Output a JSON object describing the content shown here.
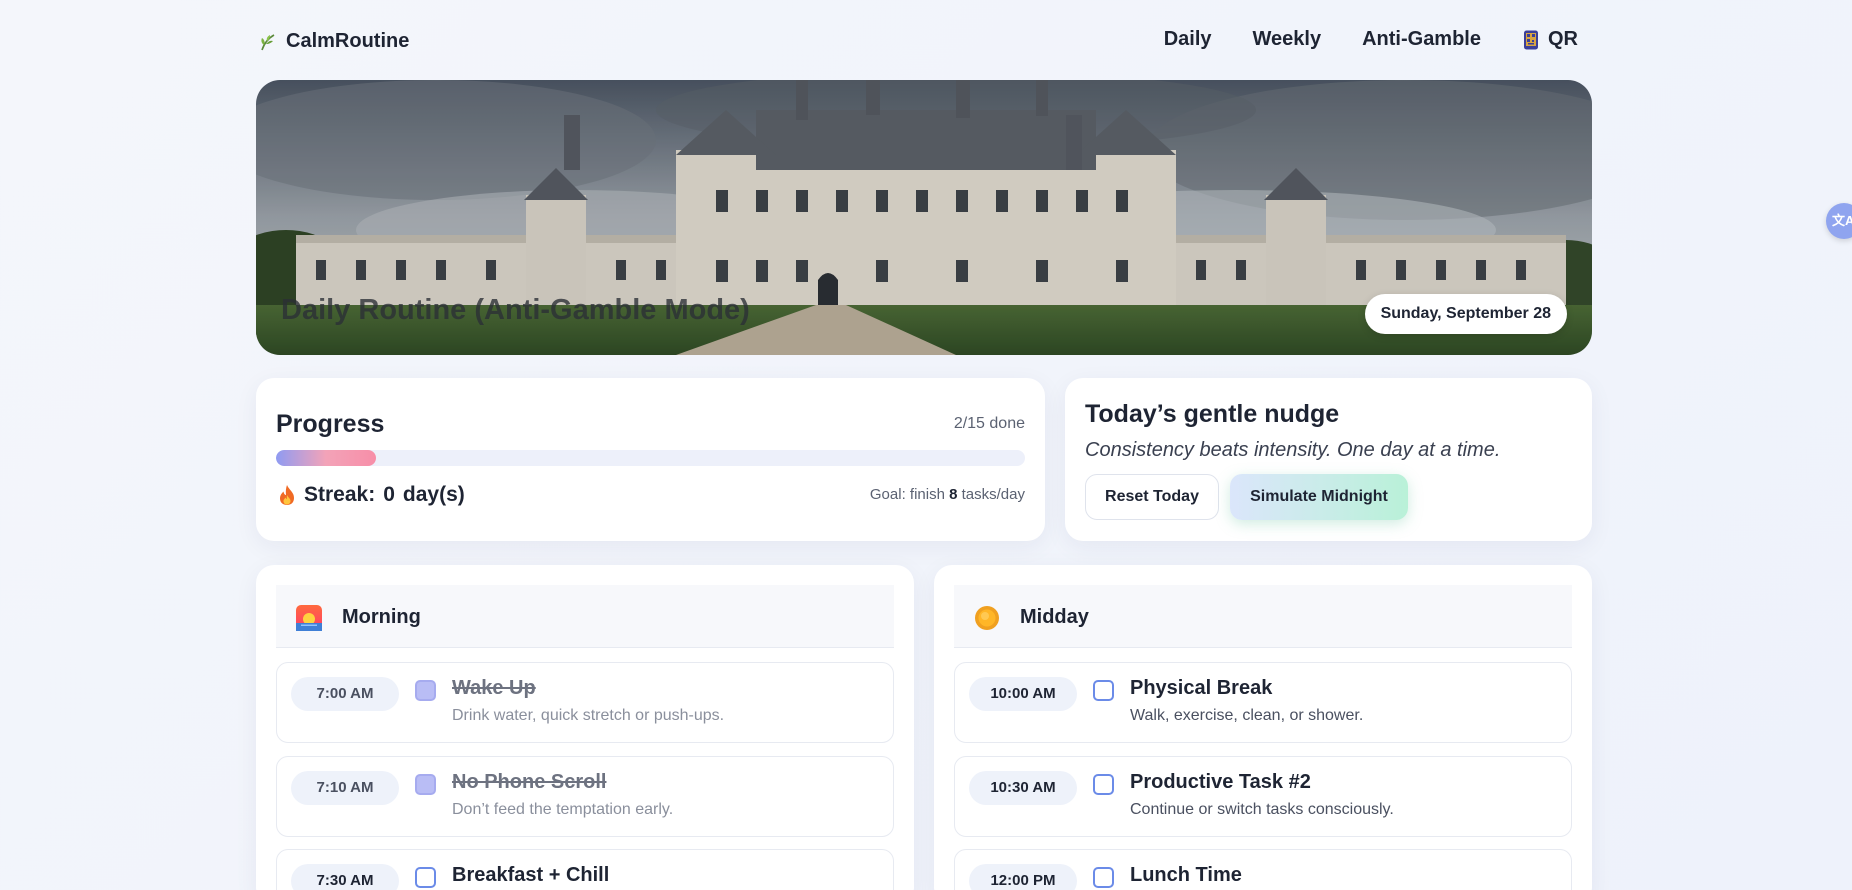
{
  "brand": {
    "name": "CalmRoutine",
    "icon": "leaf-icon"
  },
  "nav": [
    {
      "label": "Daily"
    },
    {
      "label": "Weekly"
    },
    {
      "label": "Anti-Gamble"
    },
    {
      "label": "QR",
      "icon": "qr-phone-icon"
    }
  ],
  "hero": {
    "title": "Daily Routine (Anti-Gamble Mode)",
    "date": "Sunday, September 28"
  },
  "progress": {
    "title": "Progress",
    "count_label": "2/15 done",
    "done": 2,
    "total": 15,
    "streak_label": "Streak:",
    "streak_value": "0",
    "streak_unit": "day(s)",
    "goal_prefix": "Goal: finish",
    "goal_value": "8",
    "goal_suffix": "tasks/day"
  },
  "nudge": {
    "title": "Today’s gentle nudge",
    "quote": "Consistency beats intensity. One day at a time.",
    "reset_label": "Reset Today",
    "simulate_label": "Simulate Midnight"
  },
  "sections": {
    "morning": {
      "name": "Morning",
      "icon": "sunrise-icon",
      "tasks": [
        {
          "time": "7:00 AM",
          "name": "Wake Up",
          "desc": "Drink water, quick stretch or push-ups.",
          "done": true
        },
        {
          "time": "7:10 AM",
          "name": "No Phone Scroll",
          "desc": "Don’t feed the temptation early.",
          "done": true
        },
        {
          "time": "7:30 AM",
          "name": "Breakfast + Chill",
          "desc": "",
          "done": false
        }
      ]
    },
    "midday": {
      "name": "Midday",
      "icon": "sun-icon",
      "tasks": [
        {
          "time": "10:00 AM",
          "name": "Physical Break",
          "desc": "Walk, exercise, clean, or shower.",
          "done": false
        },
        {
          "time": "10:30 AM",
          "name": "Productive Task #2",
          "desc": "Continue or switch tasks consciously.",
          "done": false
        },
        {
          "time": "12:00 PM",
          "name": "Lunch Time",
          "desc": "",
          "done": false
        }
      ]
    }
  },
  "colors": {
    "accent": "#6b8be8",
    "done_check": "#b9bdf5",
    "progress_gradient": [
      "#8f9bf2",
      "#f78ea8"
    ]
  }
}
